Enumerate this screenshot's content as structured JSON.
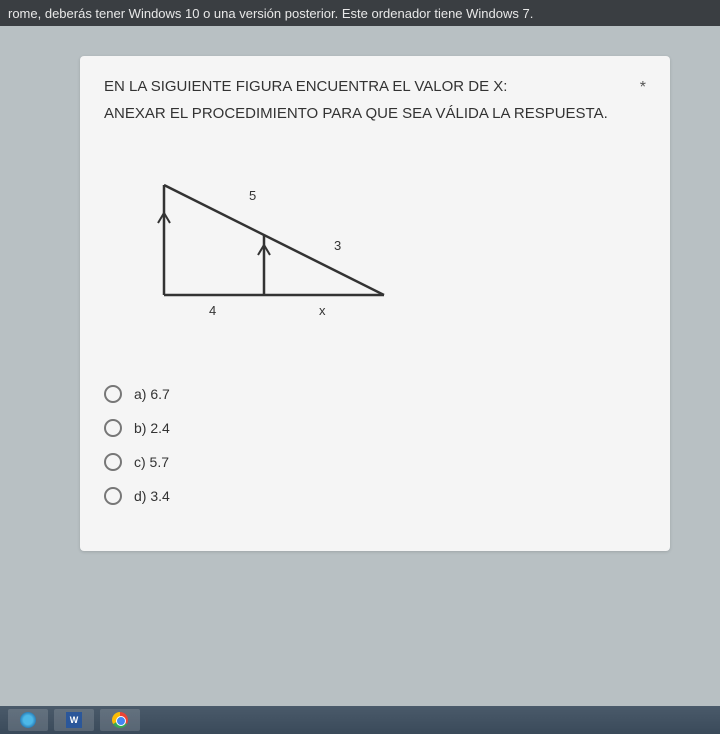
{
  "top_banner": "rome, deberás tener Windows 10 o una versión posterior. Este ordenador tiene Windows 7.",
  "question": {
    "line1": "EN LA SIGUIENTE FIGURA ENCUENTRA EL VALOR DE X:",
    "line2": "ANEXAR EL PROCEDIMIENTO PARA QUE SEA VÁLIDA LA RESPUESTA.",
    "required": "*"
  },
  "figure": {
    "labels": {
      "top_side": "5",
      "right_side": "3",
      "bottom_left": "4",
      "bottom_right": "x"
    }
  },
  "options": [
    {
      "label": "a) 6.7"
    },
    {
      "label": "b) 2.4"
    },
    {
      "label": "c) 5.7"
    },
    {
      "label": "d) 3.4"
    }
  ],
  "taskbar": {
    "word_letter": "W"
  }
}
